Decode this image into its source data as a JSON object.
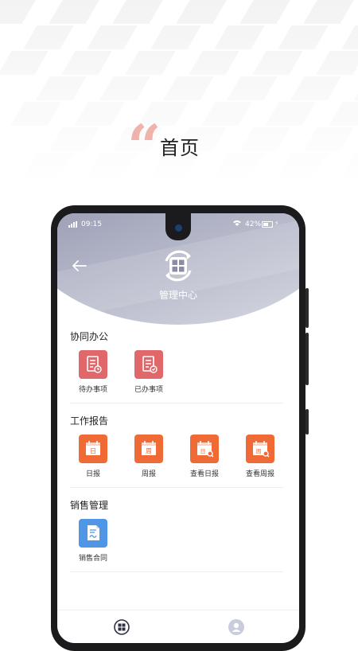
{
  "page": {
    "heading": "首页",
    "quote_glyph": "“"
  },
  "phone": {
    "status": {
      "time": "09:15",
      "battery": "42%"
    },
    "header": {
      "title": "管理中心"
    },
    "sections": [
      {
        "title": "协同办公",
        "items": [
          {
            "label": "待办事项",
            "icon": "todo-doc-icon",
            "color": "#e0686a"
          },
          {
            "label": "已办事项",
            "icon": "done-doc-icon",
            "color": "#e0686a"
          }
        ]
      },
      {
        "title": "工作报告",
        "items": [
          {
            "label": "日报",
            "icon": "daily-calendar-icon",
            "badge": "日",
            "color": "#ef6a34"
          },
          {
            "label": "周报",
            "icon": "weekly-calendar-icon",
            "badge": "周",
            "color": "#ef6a34"
          },
          {
            "label": "查看日报",
            "icon": "view-daily-icon",
            "badge": "日",
            "color": "#ef6a34"
          },
          {
            "label": "查看周报",
            "icon": "view-weekly-icon",
            "badge": "周",
            "color": "#ef6a34"
          }
        ]
      },
      {
        "title": "销售管理",
        "items": [
          {
            "label": "销售合同",
            "icon": "contract-icon",
            "color": "#4f96e6"
          }
        ]
      }
    ]
  }
}
